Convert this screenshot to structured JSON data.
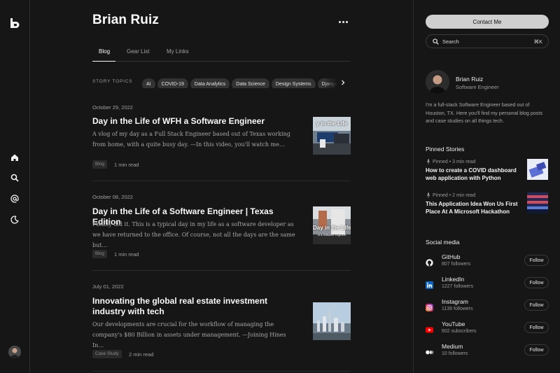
{
  "author": "Brian Ruiz",
  "tabs": [
    {
      "label": "Blog"
    },
    {
      "label": "Gear List"
    },
    {
      "label": "My Links"
    }
  ],
  "topics": {
    "label": "STORY TOPICS",
    "chips": [
      "AI",
      "COVID-19",
      "Data Analytics",
      "Data Science",
      "Design Systems",
      "Django"
    ]
  },
  "posts": [
    {
      "date": "October 29, 2022",
      "title": "Day in the Life of WFH a Software Engineer",
      "excerpt": "A vlog of my day as a Full Stack Engineer based out of Texas working from home, with a quite busy day. —In this video, you'll watch me…",
      "tag": "Blog",
      "read": "1 min read",
      "thumb_text": "y in the Life"
    },
    {
      "date": "October 08, 2022",
      "title": "Day in the Life of a Software Engineer | Texas Edition",
      "excerpt": "Finally did it. This is a typical day in my life as a software developer as we have returned to the office. Of course, not all the days are the same but…",
      "tag": "Blog",
      "read": "1 min read",
      "thumb_text": "Day in the Life",
      "thumb_sub": "of a Software Engineer"
    },
    {
      "date": "July 01, 2022",
      "title": "Innovating the global real estate investment industry with tech",
      "excerpt": "Our developments are crucial for the workflow of managing the company's $80 Billion in assets under management. —Joining Hines In…",
      "tag": "Case Study",
      "read": "2 min read"
    }
  ],
  "sidebar": {
    "contact_label": "Contact Me",
    "search_placeholder": "Search",
    "search_shortcut": "⌘K",
    "profile": {
      "name": "Brian Ruiz",
      "role": "Software Engineer",
      "bio": "I'm a full-stack Software Engineer based out of Houston, TX. Here you'll find my personal blog posts and case studies on all things tech."
    },
    "pinned_title": "Pinned Stories",
    "pinned": [
      {
        "meta": "Pinned • 3 min read",
        "title": "How to create a COVID dashboard web application with Python"
      },
      {
        "meta": "Pinned • 2 min read",
        "title": "This Application Idea Won Us First Place At A Microsoft Hackathon"
      }
    ],
    "social_title": "Social media",
    "social": [
      {
        "name": "GitHub",
        "count": "807 followers",
        "icon": "github-icon",
        "color": "#ffffff",
        "follow": "Follow"
      },
      {
        "name": "LinkedIn",
        "count": "1227 followers",
        "icon": "linkedin-icon",
        "color": "#0a66c2",
        "follow": "Follow"
      },
      {
        "name": "Instagram",
        "count": "1139 followers",
        "icon": "instagram-icon",
        "color": "#e1306c",
        "follow": "Follow"
      },
      {
        "name": "YouTube",
        "count": "602 subscribers",
        "icon": "youtube-icon",
        "color": "#ff0000",
        "follow": "Follow"
      },
      {
        "name": "Medium",
        "count": "10 followers",
        "icon": "medium-icon",
        "color": "#ffffff",
        "follow": "Follow"
      }
    ]
  },
  "colors": {
    "background": "#161616",
    "contact_button": "#cfcfcf",
    "chip": "#333333"
  }
}
